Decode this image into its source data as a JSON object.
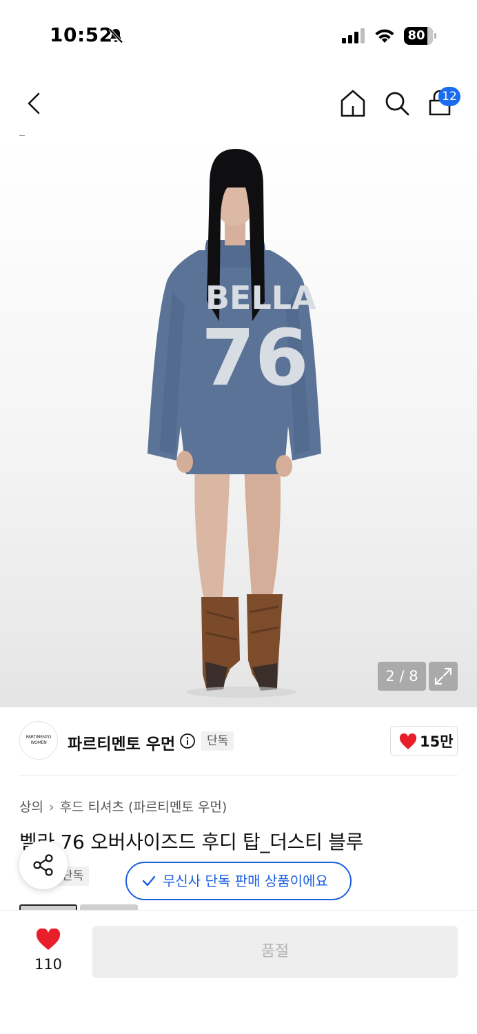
{
  "status_bar": {
    "time": "10:52",
    "battery": "80"
  },
  "header": {
    "cart_badge": "12"
  },
  "gallery": {
    "current_page": 2,
    "total_pages": 8,
    "indicator": "2 / 8",
    "jersey_text": "BELLA",
    "jersey_number": "76"
  },
  "brand": {
    "logo_line1": "PARTIMENTO",
    "logo_line2": "WOMEN",
    "name": "파르티멘토 우먼",
    "tag": "단독",
    "likes": "15만"
  },
  "breadcrumb": {
    "category": "상의",
    "subcategory": "후드 티셔츠 (파르티멘토 우먼)"
  },
  "product": {
    "title": "벨라 76 오버사이즈드 후디 탑_더스티 블루",
    "tag": "단독"
  },
  "toast": {
    "message": "무신사 단독 판매 상품이에요"
  },
  "bottom_bar": {
    "wish_count": "110",
    "soldout_label": "품절"
  },
  "colors": {
    "accent_blue": "#1a5fe0",
    "heart_red": "#e81f2a",
    "hoodie_blue": "#5b7396"
  }
}
